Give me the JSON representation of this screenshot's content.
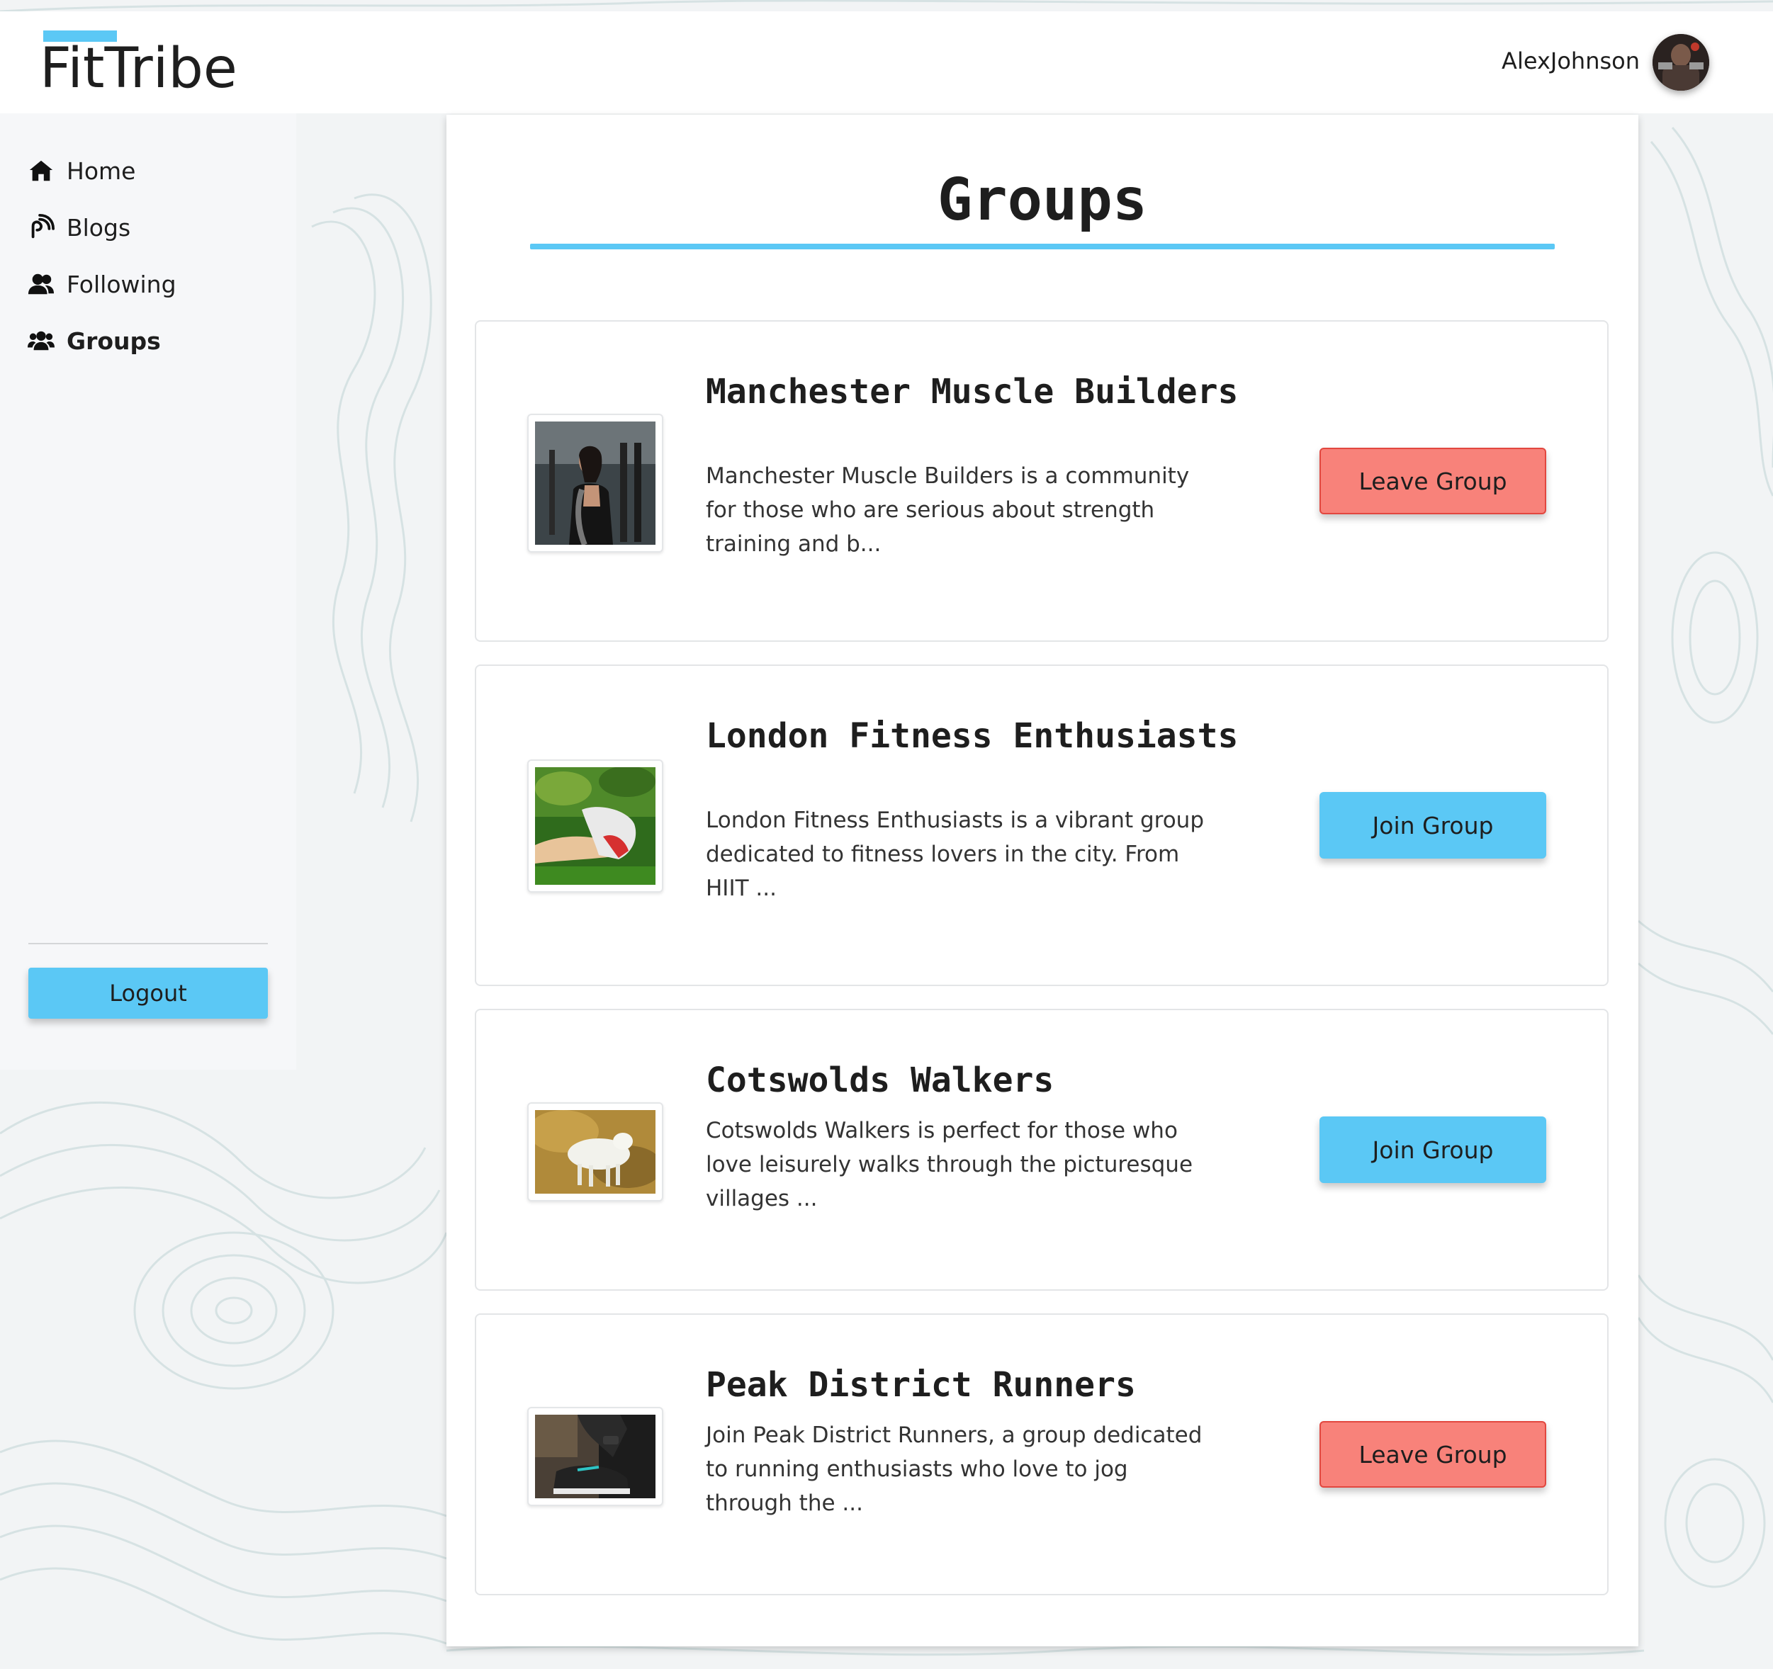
{
  "app": {
    "name": "FitTribe"
  },
  "user": {
    "name": "AlexJohnson"
  },
  "sidebar": {
    "items": [
      {
        "label": "Home",
        "icon": "home-icon",
        "active": false
      },
      {
        "label": "Blogs",
        "icon": "blog-icon",
        "active": false
      },
      {
        "label": "Following",
        "icon": "user-pair-icon",
        "active": false
      },
      {
        "label": "Groups",
        "icon": "group-icon",
        "active": true
      }
    ],
    "logout_label": "Logout"
  },
  "main": {
    "title": "Groups",
    "groups": [
      {
        "name": "Manchester Muscle Builders",
        "description": "Manchester Muscle Builders is a community for those who are serious about strength training and b...",
        "action": "Leave Group",
        "joined": true
      },
      {
        "name": "London Fitness Enthusiasts",
        "description": "London Fitness Enthusiasts is a vibrant group dedicated to fitness lovers in the city. From HIIT ...",
        "action": "Join Group",
        "joined": false
      },
      {
        "name": "Cotswolds Walkers",
        "description": "Cotswolds Walkers is perfect for those who love leisurely walks through the picturesque villages ...",
        "action": "Join Group",
        "joined": false
      },
      {
        "name": "Peak District Runners",
        "description": "Join Peak District Runners, a group dedicated to running enthusiasts who love to jog through the ...",
        "action": "Leave Group",
        "joined": true
      }
    ]
  },
  "colors": {
    "accent": "#5bc8f5",
    "leave_button": "#f8827a",
    "leave_border": "#e2473f",
    "background": "#f2f4f5"
  }
}
